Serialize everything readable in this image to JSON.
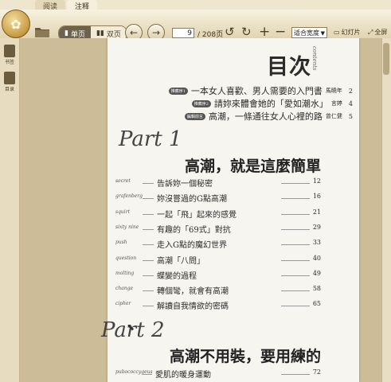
{
  "tabs": [
    {
      "label": "阅读"
    },
    {
      "label": "注释"
    }
  ],
  "toolbar": {
    "view_single": "单页",
    "view_double": "双页",
    "page_current": "9",
    "page_total": "/ 208页",
    "zoom": "适合宽度",
    "slideshow": "幻灯片",
    "fullscreen": "全屏"
  },
  "sidebar": {
    "items": [
      {
        "label": "书签"
      },
      {
        "label": "目录"
      }
    ]
  },
  "content": {
    "title": "目次",
    "title_en": "contents",
    "intro": [
      {
        "tag": "推薦序1",
        "text": "一本女人喜歡、男人需要的入門書",
        "author": "馬曉年",
        "page": "2"
      },
      {
        "tag": "推薦序2",
        "text": "請妳來體會她的「愛如潮水」",
        "author": "言婷",
        "page": "4"
      },
      {
        "tag": "編輯前言",
        "text": "高潮，一條通往女人心裡的路",
        "author": "曾仁健",
        "page": "5"
      }
    ],
    "part1": {
      "label": "Part 1",
      "title": "高潮，就是這麼簡單",
      "items": [
        {
          "en": "secret",
          "zh": "告訴妳一個秘密",
          "page": "12"
        },
        {
          "en": "grafenberg",
          "zh": "妳沒嘗過的G點高潮",
          "page": "16"
        },
        {
          "en": "squirt",
          "zh": "一起「飛」起來的感覺",
          "page": "21"
        },
        {
          "en": "sixty nine",
          "zh": "有趣的「69式」對抗",
          "page": "29"
        },
        {
          "en": "push",
          "zh": "走入G點的魔幻世界",
          "page": "33"
        },
        {
          "en": "question",
          "zh": "高潮「八問」",
          "page": "40"
        },
        {
          "en": "molting",
          "zh": "蝶變的過程",
          "page": "49"
        },
        {
          "en": "change",
          "zh": "轉個彎，就會有高潮",
          "page": "58"
        },
        {
          "en": "cipher",
          "zh": "解讀自我情欲的密碼",
          "page": "65"
        }
      ]
    },
    "part2": {
      "label": "Part 2",
      "title": "高潮不用裝，要用練的",
      "items": [
        {
          "en": "pubococcygeus",
          "zh": "愛肌的暖身運動",
          "page": "72"
        }
      ]
    }
  }
}
